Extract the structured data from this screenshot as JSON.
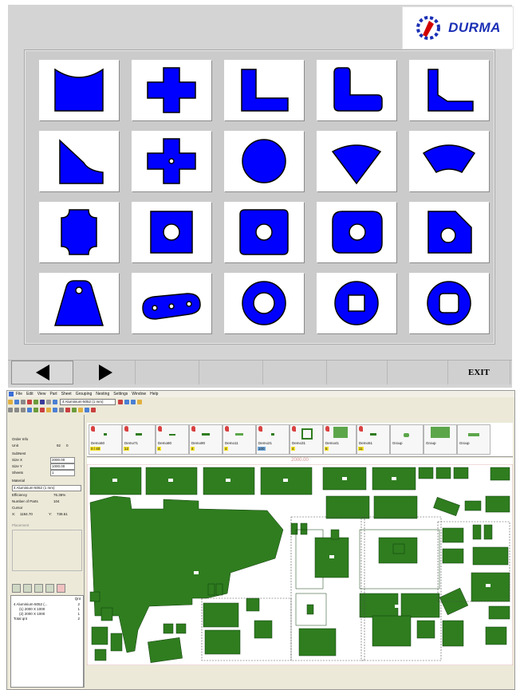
{
  "logo": {
    "text": "DURMA"
  },
  "colors": {
    "shape_fill": "#0000ff",
    "panel_bg": "#d4d4d4",
    "part_fill": "#2f7d1f",
    "qty_badge": "#f4e12a"
  },
  "shapes": [
    {
      "name": "rect-concave-top"
    },
    {
      "name": "cross"
    },
    {
      "name": "l-shape"
    },
    {
      "name": "l-shape-rounded"
    },
    {
      "name": "l-shape-chamfer"
    },
    {
      "name": "triangle-concave"
    },
    {
      "name": "cross-with-hole"
    },
    {
      "name": "circle"
    },
    {
      "name": "sector"
    },
    {
      "name": "arc-segment"
    },
    {
      "name": "octagon-notched"
    },
    {
      "name": "square-with-hole"
    },
    {
      "name": "rounded-square-with-hole"
    },
    {
      "name": "rounded-rect-with-hole"
    },
    {
      "name": "chamfered-square-with-hole"
    },
    {
      "name": "trapezoid-with-hole"
    },
    {
      "name": "link-plate"
    },
    {
      "name": "ring"
    },
    {
      "name": "ring-square-hole"
    },
    {
      "name": "ring-rounded-square-hole"
    }
  ],
  "nav": {
    "back": "back-arrow",
    "forward": "forward-arrow",
    "exit_label": "EXIT"
  },
  "app": {
    "menu": [
      "File",
      "Edit",
      "View",
      "Part",
      "Sheet",
      "Grouping",
      "Nesting",
      "Settings",
      "Window",
      "Help"
    ],
    "material_combo": "4  Aluminium-5052  (1 mm)",
    "order_info": {
      "title": "Order Info",
      "unit_label": "Unit",
      "unit_value": "92",
      "unit_value2": "0",
      "sheet_group": "SubNest",
      "size_x_label": "Size X",
      "size_x": "2000.00",
      "size_y_label": "Size Y",
      "size_y": "1000.00",
      "sheets_label": "Sheets",
      "sheets": "1",
      "material_label": "Material",
      "material": "4  Aluminium-5052  (1 mm)",
      "efficiency_label": "Efficiency",
      "efficiency": "76.36%",
      "parts_label": "Number of Parts",
      "parts": "104",
      "cursor_label": "Cursor",
      "cursor_x_label": "X:",
      "cursor_x": "1194.70",
      "cursor_y_label": "Y:",
      "cursor_y": "739.61",
      "placement_label": "Placement"
    },
    "tree": {
      "qnt_header": "Qnt",
      "rows": [
        {
          "label": "4   Aluminium-5052 (...",
          "qty": "2"
        },
        {
          "label": "(1) 2000 X 1000",
          "qty": "1"
        },
        {
          "label": "(2) 2000 X 1000",
          "qty": "1"
        },
        {
          "label": "Total qnt",
          "qty": "2"
        }
      ]
    },
    "parts": [
      {
        "name": "Demo60",
        "qty": "0 / 40"
      },
      {
        "name": "Demo71",
        "qty": "12"
      },
      {
        "name": "Demo80",
        "qty": "4"
      },
      {
        "name": "Demo90",
        "qty": "4"
      },
      {
        "name": "Demo11",
        "qty": "4"
      },
      {
        "name": "Demo21",
        "qty": "100",
        "selected": true
      },
      {
        "name": "Demo31",
        "qty": "4"
      },
      {
        "name": "Demo41",
        "qty": "6"
      },
      {
        "name": "Demo51",
        "qty": "11"
      },
      {
        "name": "Group",
        "qty": ""
      },
      {
        "name": "Group",
        "qty": ""
      },
      {
        "name": "Group",
        "qty": ""
      }
    ],
    "sheet_width_label": "2000.00"
  }
}
